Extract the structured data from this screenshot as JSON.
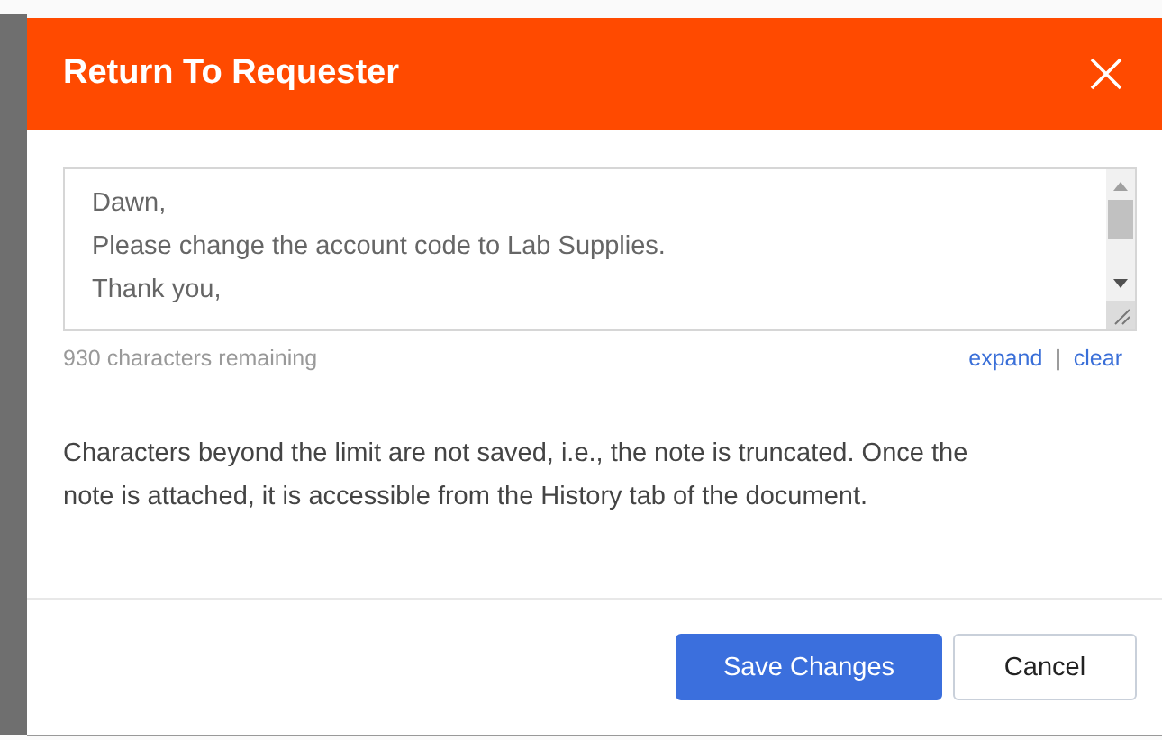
{
  "dialog": {
    "title": "Return To Requester",
    "note": {
      "value": "Dawn,\nPlease change the account code to Lab Supplies.\nThank you,",
      "counter": "930 characters remaining",
      "links": [
        "expand",
        "clear"
      ],
      "separator": "|"
    },
    "info": "Characters beyond the limit are not saved, i.e., the note is truncated. Once the note is attached, it is accessible from the History tab of the document.",
    "buttons": [
      {
        "label": "Save Changes",
        "kind": "primary"
      },
      {
        "label": "Cancel",
        "kind": "secondary"
      }
    ]
  }
}
